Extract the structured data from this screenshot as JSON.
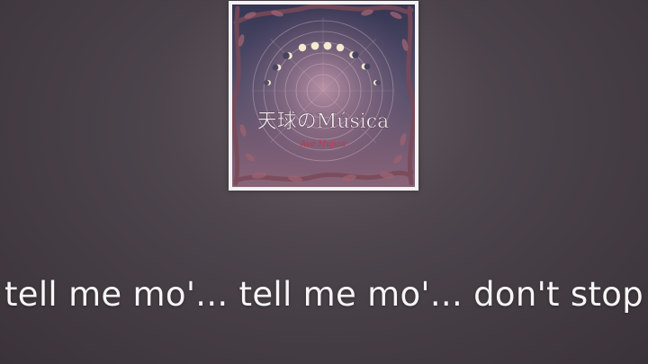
{
  "album": {
    "title": "天球のMúsica",
    "artist": "Ave Mujica",
    "colors": {
      "border": "#f4f1f3",
      "sky_top": "#3b3d5c",
      "sky_bottom": "#7a5a72",
      "vine": "#8a5a66",
      "title_text": "#f2e9ee",
      "artist_text": "#c0354a"
    }
  },
  "lyric": {
    "text": "tell me mo'... tell me mo'... don't stop",
    "color": "#f7f5f6"
  },
  "background": {
    "colors": {
      "center": "#5a5158",
      "edge": "#3a3339"
    }
  }
}
